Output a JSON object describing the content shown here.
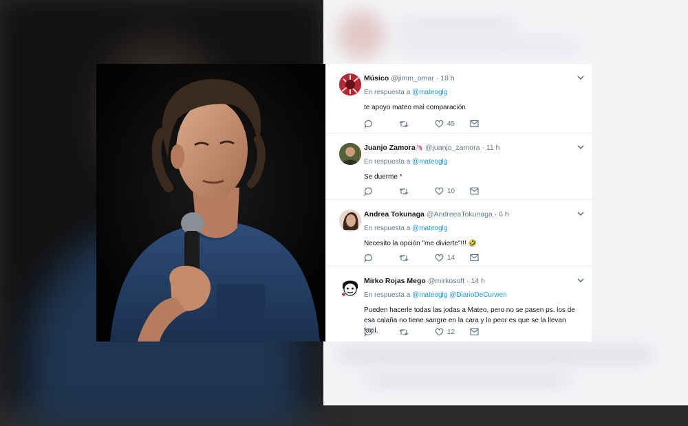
{
  "tweets": [
    {
      "name": "Músico",
      "name_suffix": "",
      "handle": "@jimm_omar",
      "time": "· 18 h",
      "reply_prefix": "En respuesta a",
      "mentions": "@mateoglg",
      "text": "te apoyo mateo mal comparación",
      "likes": "45",
      "avatar_color": "#b22a36"
    },
    {
      "name": "Juanjo Zamora",
      "name_suffix": "🦄",
      "handle": "@juanjo_zamora",
      "time": "· 11 h",
      "reply_prefix": "En respuesta a",
      "mentions": "@mateoglg",
      "text": "Se duerme *",
      "likes": "10",
      "avatar_color": "#6d7a4a"
    },
    {
      "name": "Andrea Tokunaga",
      "name_suffix": "",
      "handle": "@AndreeaTokunaga",
      "time": "· 6 h",
      "reply_prefix": "En respuesta a",
      "mentions": "@mateoglg",
      "text": "Necesito la opción \"me divierte\"!!! 🤣",
      "likes": "14",
      "avatar_color": "#c9a48c"
    },
    {
      "name": "Mirko Rojas Mego",
      "name_suffix": "",
      "handle": "@mirkosoft",
      "time": "· 14 h",
      "reply_prefix": "En respuesta a",
      "mentions": "@mateoglg @DiarioDeCurwen",
      "text": "Pueden hacerle todas las jodas a Mateo, pero no se pasen ps. los de esa calaña no tiene sangre en la cara y lo peor es que se la llevan facil.",
      "likes": "12",
      "avatar_color": "#ffffff"
    }
  ],
  "colors": {
    "link": "#1b95e0",
    "muted": "#657786",
    "text": "#14171a",
    "divider": "#e6ecf0"
  }
}
